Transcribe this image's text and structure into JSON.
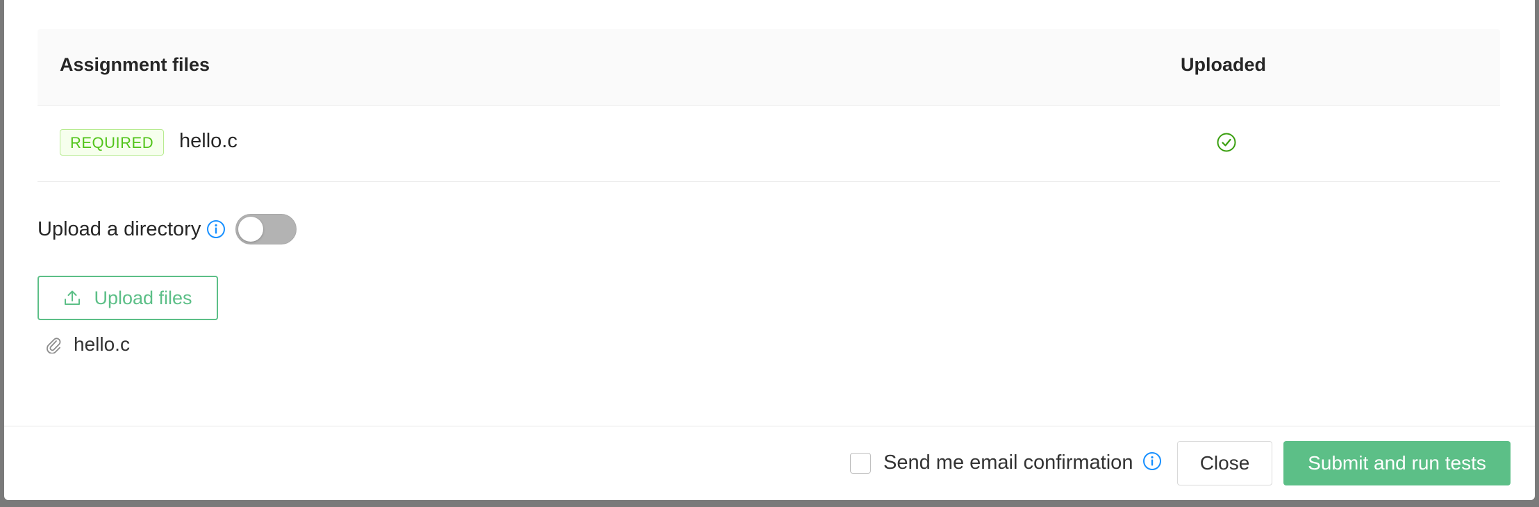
{
  "table": {
    "header_files": "Assignment files",
    "header_uploaded": "Uploaded",
    "rows": [
      {
        "tag": "REQUIRED",
        "file": "hello.c",
        "uploaded_icon": "check-circle-icon"
      }
    ]
  },
  "upload_directory": {
    "label": "Upload a directory",
    "info_icon": "info-circle-icon",
    "enabled": false
  },
  "upload_button": {
    "label": "Upload files",
    "icon": "upload-icon"
  },
  "attached_files": [
    {
      "name": "hello.c",
      "icon": "paperclip-icon"
    }
  ],
  "footer": {
    "email_confirmation_label": "Send me email confirmation",
    "email_confirmation_checked": false,
    "close_label": "Close",
    "submit_label": "Submit and run tests"
  },
  "colors": {
    "primary_green": "#5cbf87",
    "tag_green": "#52c41a",
    "info_blue": "#1890ff",
    "check_green": "#389e0d"
  }
}
